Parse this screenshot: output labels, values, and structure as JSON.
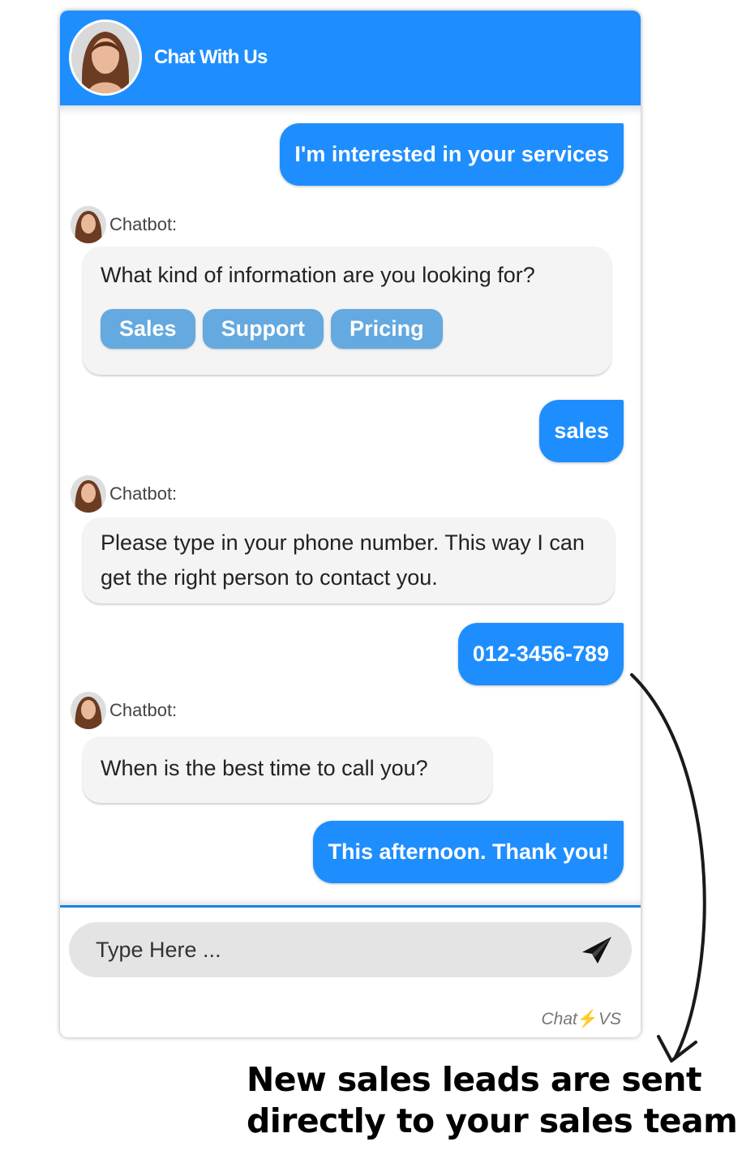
{
  "header": {
    "title": "Chat With Us",
    "avatar_icon": "agent-avatar"
  },
  "messages": [
    {
      "from": "user",
      "text": "I'm interested in your services"
    },
    {
      "from": "bot",
      "label": "Chatbot:",
      "text": "What kind of information are you looking for?",
      "quick_replies": [
        "Sales",
        "Support",
        "Pricing"
      ]
    },
    {
      "from": "user",
      "text": "sales"
    },
    {
      "from": "bot",
      "label": "Chatbot:",
      "text": "Please type in your phone number. This way I can get the right person to contact you."
    },
    {
      "from": "user",
      "text": "012-3456-789"
    },
    {
      "from": "bot",
      "label": "Chatbot:",
      "text": "When is the best time to call you?"
    },
    {
      "from": "user",
      "text": "This afternoon. Thank you!"
    }
  ],
  "input": {
    "placeholder": "Type Here ...",
    "value": "",
    "send_icon": "paper-plane-icon"
  },
  "branding": {
    "prefix": "Chat",
    "bolt": "⚡",
    "suffix": "VS"
  },
  "caption": {
    "line1": "New sales leads are sent",
    "line2": "directly to your sales team"
  },
  "colors": {
    "accent": "#1e8eff",
    "chip": "#64a9df",
    "bot_bubble": "#f4f4f4",
    "divider": "#1a83e6"
  }
}
